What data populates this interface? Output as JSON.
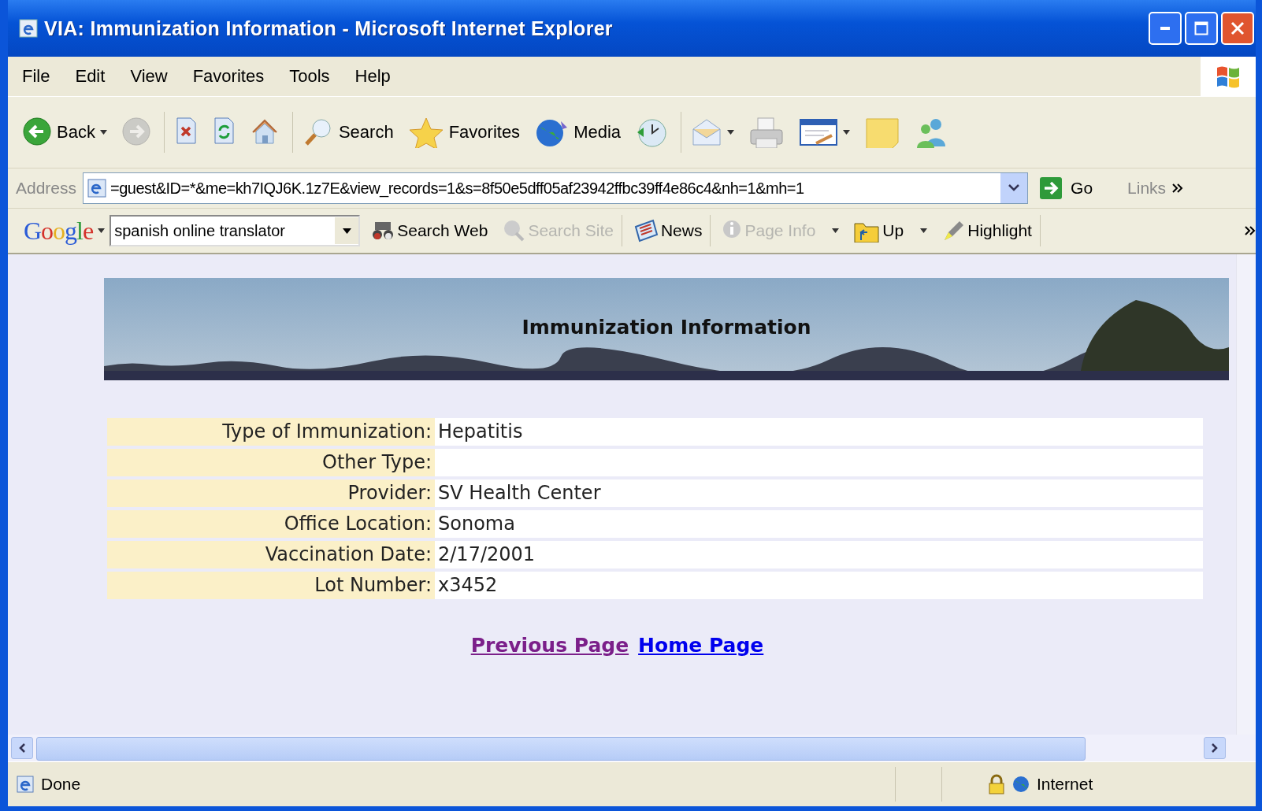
{
  "window": {
    "title": "VIA: Immunization Information - Microsoft Internet Explorer"
  },
  "menu": [
    "File",
    "Edit",
    "View",
    "Favorites",
    "Tools",
    "Help"
  ],
  "toolbar": [
    {
      "kind": "back",
      "label": "Back",
      "disabled": false,
      "dropdown": true
    },
    {
      "kind": "forward",
      "disabled": true,
      "dropdown": false
    },
    {
      "kind": "stop",
      "disabled": false,
      "dropdown": false
    },
    {
      "kind": "refresh",
      "disabled": false,
      "dropdown": false
    },
    {
      "kind": "home",
      "disabled": false,
      "dropdown": false
    },
    {
      "kind": "search",
      "label": "Search",
      "disabled": false,
      "dropdown": false
    },
    {
      "kind": "favorites",
      "label": "Favorites",
      "disabled": false,
      "dropdown": false
    },
    {
      "kind": "media",
      "label": "Media",
      "disabled": false,
      "dropdown": false
    },
    {
      "kind": "history",
      "disabled": false,
      "dropdown": false
    },
    {
      "kind": "mail",
      "disabled": false,
      "dropdown": true
    },
    {
      "kind": "print",
      "disabled": false,
      "dropdown": false
    },
    {
      "kind": "edit",
      "disabled": false,
      "dropdown": true
    },
    {
      "kind": "note",
      "disabled": false,
      "dropdown": false
    },
    {
      "kind": "messenger",
      "disabled": false,
      "dropdown": false
    }
  ],
  "address": {
    "label": "Address",
    "value": "=guest&ID=*&me=kh7IQJ6K.1z7E&view_records=1&s=8f50e5dff05af23942ffbc39ff4e86c4&nh=1&mh=1",
    "go": "Go",
    "links": "Links"
  },
  "google": {
    "logo": "Google",
    "query": "spanish online translator",
    "buttons": [
      {
        "kind": "binoculars",
        "label": "Search Web",
        "disabled": false,
        "dropdown": false
      },
      {
        "kind": "site",
        "label": "Search Site",
        "disabled": true,
        "dropdown": false
      },
      {
        "kind": "news",
        "label": "News",
        "disabled": false,
        "dropdown": false
      },
      {
        "kind": "info",
        "label": "Page Info",
        "disabled": true,
        "dropdown": true
      },
      {
        "kind": "up",
        "label": "Up",
        "disabled": false,
        "dropdown": true
      },
      {
        "kind": "highlight",
        "label": "Highlight",
        "disabled": false,
        "dropdown": false
      }
    ]
  },
  "page": {
    "banner_title": "Immunization Information",
    "fields": [
      {
        "label": "Type of Immunization:",
        "value": "Hepatitis"
      },
      {
        "label": "Other Type:"
      },
      {
        "label": "Provider:",
        "value": "SV Health Center"
      },
      {
        "label": "Office Location:",
        "value": "Sonoma"
      },
      {
        "label": "Vaccination Date:",
        "value": "2/17/2001"
      },
      {
        "label": "Lot Number:",
        "value": "x3452"
      }
    ],
    "links": [
      {
        "label": "Previous Page",
        "visited": true
      },
      {
        "label": "Home Page",
        "visited": false
      }
    ]
  },
  "status_bar": {
    "text": "Done",
    "zone": "Internet"
  }
}
